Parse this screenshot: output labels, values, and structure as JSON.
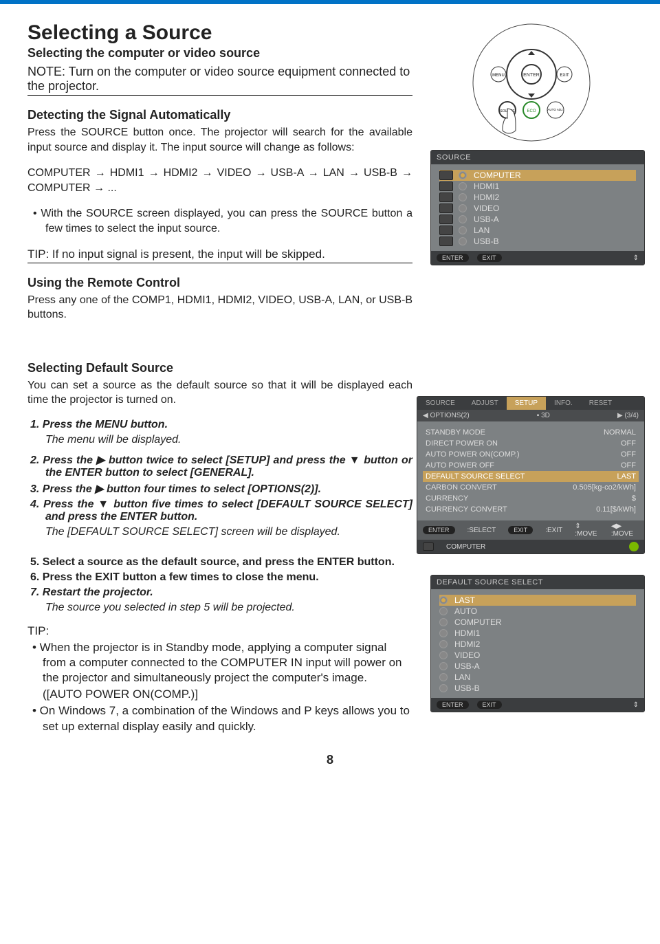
{
  "page_number": "8",
  "title": "Selecting a Source",
  "subtitle": "Selecting the computer or video source",
  "note": "NOTE: Turn on the computer or video source equipment connected to the projector.",
  "detect_heading": "Detecting the Signal Automatically",
  "detect_p1": "Press the SOURCE button once. The projector will search for the available input source and display it. The input source will change as follows:",
  "detect_chain": "COMPUTER → HDMI1 → HDMI2 → VIDEO → USB-A → LAN → USB-B → COMPUTER → ...",
  "detect_bullet": "•   With the SOURCE screen displayed, you can press the SOURCE button a few times to select the input source.",
  "tip1": "TIP: If no input signal is present, the input will be skipped.",
  "remote_heading": "Using the Remote Control",
  "remote_p": "Press any one of the COMP1, HDMI1, HDMI2, VIDEO, USB-A, LAN, or USB-B buttons.",
  "default_heading": "Selecting Default Source",
  "default_p": "You can set a source as the default source so that it will be displayed each time the projector is turned on.",
  "steps": {
    "s1": "1.  Press the MENU button.",
    "s1n": "The menu will be displayed.",
    "s2": "2.  Press the ▶ button twice to select [SETUP] and press the ▼ button or the ENTER button to select [GENERAL].",
    "s3": "3.  Press the ▶ button four times to select [OPTIONS(2)].",
    "s4": "4.  Press the ▼ button five times to select [DEFAULT SOURCE SELECT] and press the ENTER button.",
    "s4n": "The [DEFAULT SOURCE SELECT] screen will be displayed.",
    "s5": "5.  Select a source as the default source, and press the ENTER button.",
    "s6": "6.  Press the EXIT button a few times to close the menu.",
    "s7": "7.  Restart the projector.",
    "s7n": "The source you selected in step 5 will be projected."
  },
  "tip2_head": "TIP:",
  "tip2_b1": "•  When the projector is in Standby mode, applying a computer signal from a computer connected to the COMPUTER IN input will power on the projector and simultaneously project the computer's image.",
  "tip2_b1b": "([AUTO POWER ON(COMP.)]",
  "tip2_b2": "•  On Windows 7, a combination of the Windows and P keys allows you to set up external display easily and quickly.",
  "osd_source": {
    "title": "SOURCE",
    "items": [
      "COMPUTER",
      "HDMI1",
      "HDMI2",
      "VIDEO",
      "USB-A",
      "LAN",
      "USB-B"
    ],
    "footer": [
      "ENTER",
      "EXIT"
    ]
  },
  "osd_setup": {
    "tabs": [
      "SOURCE",
      "ADJUST",
      "SETUP",
      "INFO.",
      "RESET"
    ],
    "active_tab": "SETUP",
    "sub_left": "◀ OPTIONS(2)",
    "sub_mid": "▪ 3D",
    "sub_right": "▶ (3/4)",
    "rows": [
      {
        "k": "STANDBY MODE",
        "v": "NORMAL"
      },
      {
        "k": "DIRECT POWER ON",
        "v": "OFF"
      },
      {
        "k": "AUTO POWER ON(COMP.)",
        "v": "OFF"
      },
      {
        "k": "AUTO POWER OFF",
        "v": "OFF"
      },
      {
        "k": "DEFAULT SOURCE SELECT",
        "v": "LAST",
        "sel": true
      },
      {
        "k": "CARBON CONVERT",
        "v": "0.505[kg-co2/kWh]"
      },
      {
        "k": "CURRENCY",
        "v": "$"
      },
      {
        "k": "CURRENCY CONVERT",
        "v": "0.11[$/kWh]"
      }
    ],
    "foot1": {
      "enter": "ENTER",
      "enter_t": ":SELECT",
      "exit": "EXIT",
      "exit_t": ":EXIT",
      "move1": "⇕  :MOVE",
      "move2": "◀▶ :MOVE"
    },
    "foot2_label": "COMPUTER"
  },
  "osd_dss": {
    "title": "DEFAULT SOURCE SELECT",
    "items": [
      "LAST",
      "AUTO",
      "COMPUTER",
      "HDMI1",
      "HDMI2",
      "VIDEO",
      "USB-A",
      "LAN",
      "USB-B"
    ],
    "footer": [
      "ENTER",
      "EXIT"
    ]
  },
  "remote_labels": {
    "menu": "MENU",
    "enter": "ENTER",
    "exit": "EXIT",
    "source": "SOURCE",
    "eco": "ECO",
    "auto": "AUTO ADJ."
  }
}
